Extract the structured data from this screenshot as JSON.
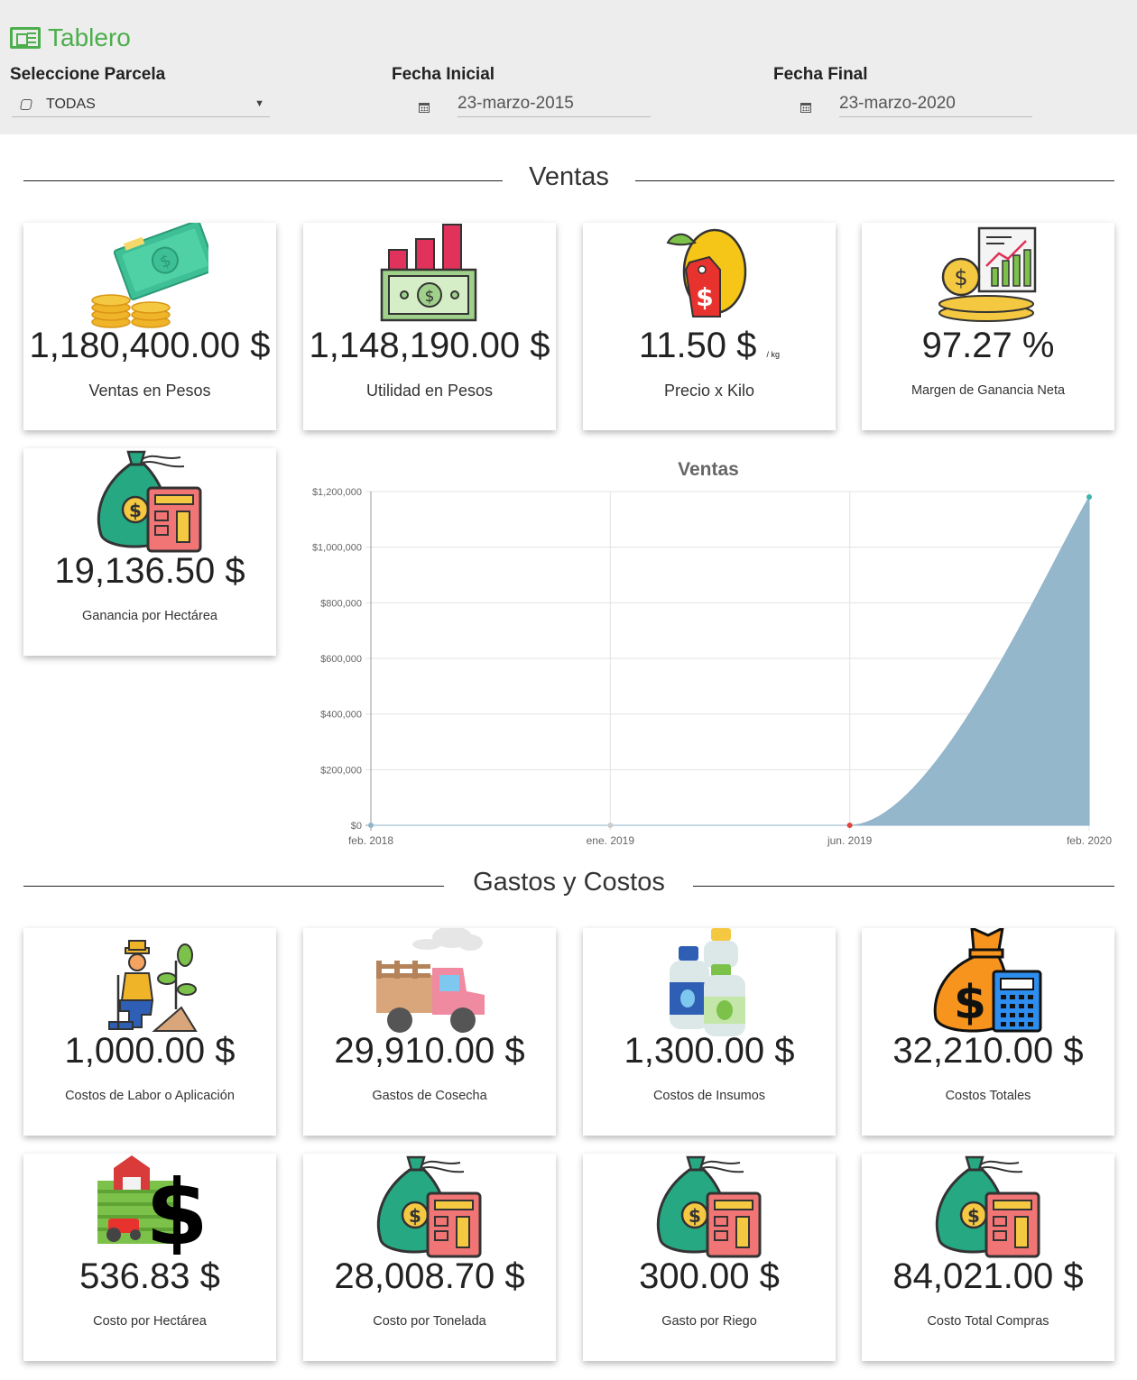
{
  "header": {
    "title": "Tablero",
    "parcela_label": "Seleccione Parcela",
    "parcela_value": "TODAS",
    "fecha_inicial_label": "Fecha Inicial",
    "fecha_inicial_value": "23-marzo-2015",
    "fecha_final_label": "Fecha Final",
    "fecha_final_value": "23-marzo-2020"
  },
  "sections": {
    "ventas": "Ventas",
    "gastos": "Gastos y Costos"
  },
  "ventas_cards": [
    {
      "value": "1,180,400.00 $",
      "label": "Ventas en Pesos",
      "icon": "money-icon"
    },
    {
      "value": "1,148,190.00 $",
      "label": "Utilidad en Pesos",
      "icon": "profit-icon"
    },
    {
      "value": "11.50 $",
      "unit": "/ kg",
      "label": "Precio x Kilo",
      "icon": "lemon-price-icon"
    },
    {
      "value": "97.27 %",
      "label": "Margen de Ganancia Neta",
      "icon": "margin-report-icon"
    },
    {
      "value": "19,136.50 $",
      "label": "Ganancia por Hectárea",
      "icon": "money-bag-calculator-icon"
    }
  ],
  "gastos_cards": [
    {
      "value": "1,000.00 $",
      "label": "Costos de Labor o Aplicación",
      "icon": "farmer-icon"
    },
    {
      "value": "29,910.00 $",
      "label": "Gastos de Cosecha",
      "icon": "truck-icon"
    },
    {
      "value": "1,300.00 $",
      "label": "Costos de Insumos",
      "icon": "bottles-icon"
    },
    {
      "value": "32,210.00 $",
      "label": "Costos Totales",
      "icon": "moneybag-calculator-orange-icon"
    },
    {
      "value": "536.83 $",
      "label": "Costo por Hectárea",
      "icon": "farm-dollar-icon"
    },
    {
      "value": "28,008.70 $",
      "label": "Costo por Tonelada",
      "icon": "money-bag-calculator-icon"
    },
    {
      "value": "300.00 $",
      "label": "Gasto por Riego",
      "icon": "money-bag-calculator-icon"
    },
    {
      "value": "84,021.00 $",
      "label": "Costo Total Compras",
      "icon": "money-bag-calculator-icon"
    }
  ],
  "chart_data": {
    "type": "area",
    "title": "Ventas",
    "x": [
      "feb. 2018",
      "ene. 2019",
      "jun. 2019",
      "feb. 2020"
    ],
    "series": [
      {
        "values": [
          0,
          0,
          0,
          1180400
        ],
        "color": "#8fb3c9"
      }
    ],
    "y_ticks": [
      "$0",
      "$200,000",
      "$400,000",
      "$600,000",
      "$800,000",
      "$1,000,000",
      "$1,200,000"
    ],
    "ylim": [
      0,
      1200000
    ],
    "point_colors": [
      "#8fb3c9",
      "#cccccc",
      "#e0443c",
      "#3bb6a8"
    ],
    "grid": true,
    "legend": "none"
  }
}
